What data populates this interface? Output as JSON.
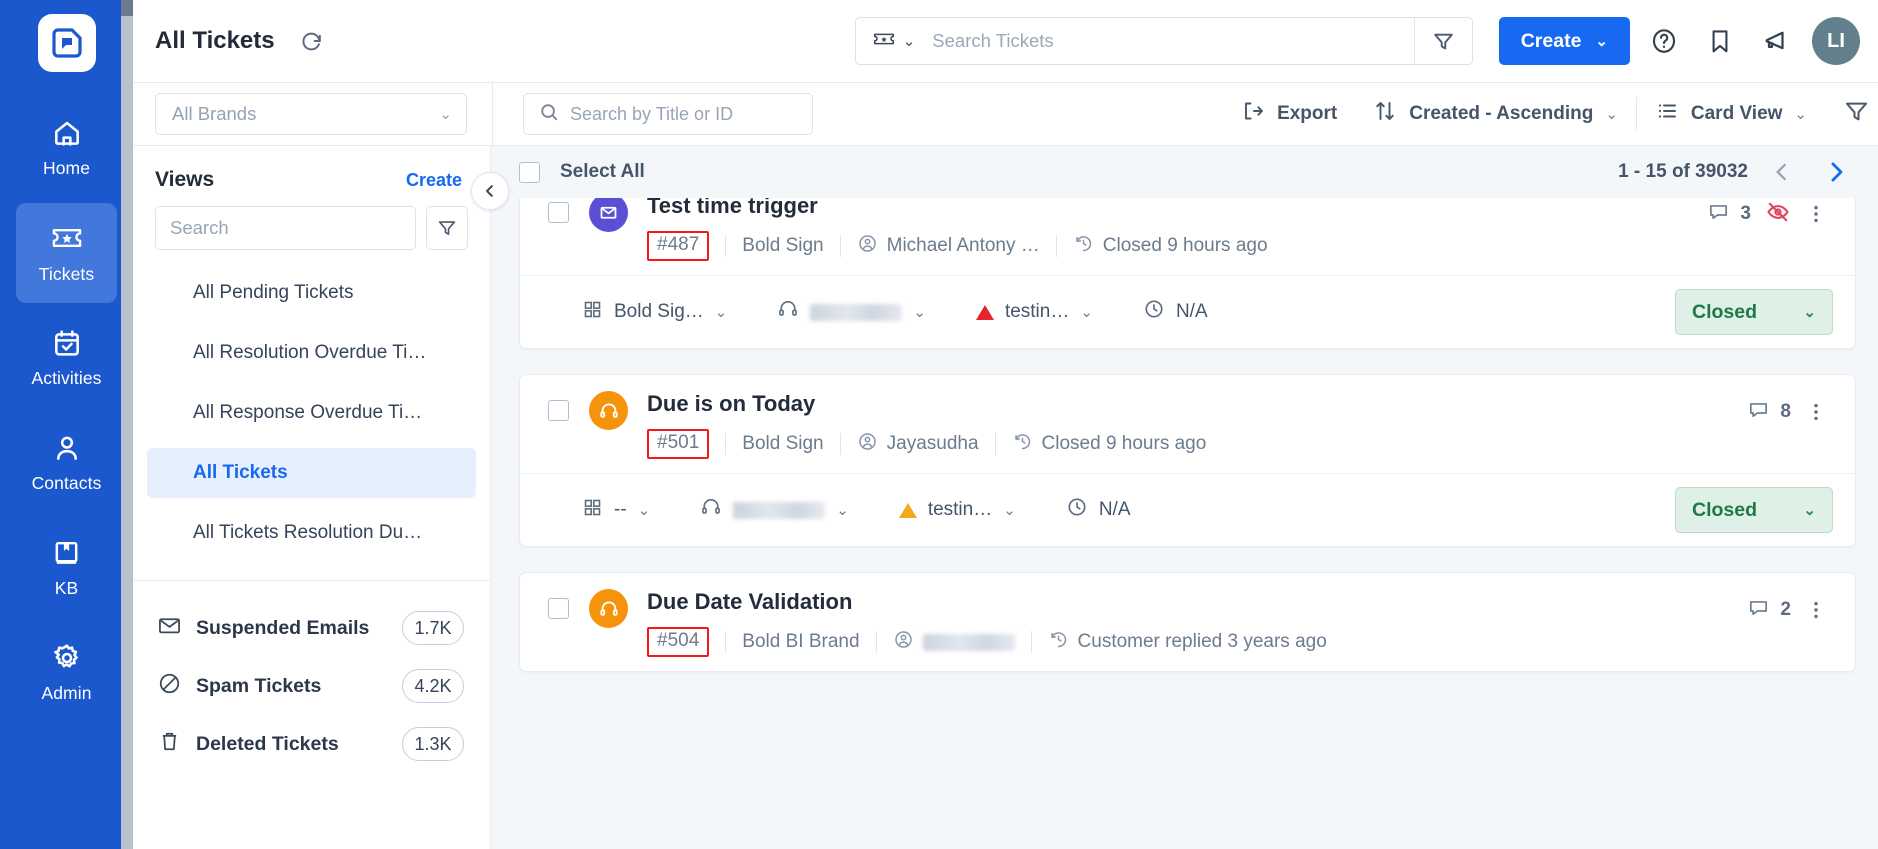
{
  "colors": {
    "rail_bg": "#1c58cd",
    "rail_active": "#4277dc",
    "accent": "#1869f1",
    "highlight_box": "#ee1c1c",
    "status_closed_bg": "#dff0e6",
    "status_closed_text": "#1d7a46",
    "priority_urgent": "#e7232c",
    "priority_high": "#f6a81c"
  },
  "rail": {
    "logo_icon": "bold-desk-logo-icon",
    "items": [
      {
        "label": "Home",
        "icon": "home-icon",
        "active": false
      },
      {
        "label": "Tickets",
        "icon": "ticket-icon",
        "active": true
      },
      {
        "label": "Activities",
        "icon": "calendar-check-icon",
        "active": false
      },
      {
        "label": "Contacts",
        "icon": "person-icon",
        "active": false
      },
      {
        "label": "KB",
        "icon": "book-bookmark-icon",
        "active": false
      },
      {
        "label": "Admin",
        "icon": "gear-icon",
        "active": false
      }
    ]
  },
  "topbar": {
    "title": "All Tickets",
    "refresh_icon": "refresh-icon",
    "search": {
      "type_icon": "ticket-icon",
      "type_chevron": "⌄",
      "placeholder": "Search Tickets",
      "value": "",
      "filter_icon": "funnel-icon"
    },
    "create_label": "Create",
    "create_chevron": "⌄",
    "icons": [
      {
        "name": "help-circle-icon",
        "glyph": "?"
      },
      {
        "name": "bookmark-icon",
        "glyph": ""
      },
      {
        "name": "megaphone-icon",
        "glyph": ""
      }
    ],
    "avatar_initials": "LI"
  },
  "toolbar": {
    "brand_filter": {
      "value": "All Brands",
      "chevron": "⌄"
    },
    "title_search": {
      "placeholder": "Search by Title or ID",
      "value": "",
      "icon": "search-icon"
    },
    "export_label": "Export",
    "export_icon": "export-icon",
    "sort_label": "Created - Ascending",
    "sort_icon": "sort-icon",
    "sort_chevron": "⌄",
    "view_label": "Card View",
    "view_icon": "list-icon",
    "view_chevron": "⌄",
    "filter_icon": "funnel-icon"
  },
  "views_panel": {
    "heading": "Views",
    "create_label": "Create",
    "collapse_icon": "chevron-left-icon",
    "search": {
      "placeholder": "Search",
      "value": ""
    },
    "filter_icon": "funnel-icon",
    "items": [
      {
        "label": "All Pending Tickets",
        "active": false
      },
      {
        "label": "All Resolution Overdue Ti…",
        "active": false
      },
      {
        "label": "All Response Overdue Ti…",
        "active": false
      },
      {
        "label": "All Tickets",
        "active": true
      },
      {
        "label": "All Tickets Resolution Du…",
        "active": false
      }
    ],
    "system_items": [
      {
        "label": "Suspended Emails",
        "count": "1.7K",
        "icon": "envelope-icon"
      },
      {
        "label": "Spam Tickets",
        "count": "4.2K",
        "icon": "ban-icon"
      },
      {
        "label": "Deleted Tickets",
        "count": "1.3K",
        "icon": "trash-icon"
      }
    ]
  },
  "list": {
    "select_all_label": "Select All",
    "pager_text": "1 - 15 of 39032",
    "prev_icon": "chevron-left-icon",
    "next_icon": "chevron-right-icon",
    "tickets": [
      {
        "title": "Test time trigger",
        "channel_icon": "email-icon",
        "channel_type": "mail",
        "id": "#487",
        "brand": "Bold Sign",
        "requester": "Michael Antony …",
        "requester_icon": "user-circle-icon",
        "activity": "Closed 9 hours ago",
        "activity_icon": "history-icon",
        "conversation_count": "3",
        "conversation_icon": "comment-icon",
        "has_eye_off": true,
        "eye_off_icon": "eye-off-icon",
        "kebab_icon": "kebab-menu-icon",
        "group": {
          "label": "Bold Sig…",
          "icon": "grid-icon"
        },
        "agent": {
          "label": "",
          "blurred": true,
          "icon": "headset-icon"
        },
        "priority": {
          "label": "testin…",
          "level": "urgent"
        },
        "due": {
          "label": "N/A",
          "icon": "clock-icon"
        },
        "status": "Closed"
      },
      {
        "title": "Due is on Today",
        "channel_icon": "headset-icon",
        "channel_type": "phone",
        "id": "#501",
        "brand": "Bold Sign",
        "requester": "Jayasudha",
        "requester_icon": "user-circle-icon",
        "activity": "Closed 9 hours ago",
        "activity_icon": "history-icon",
        "conversation_count": "8",
        "conversation_icon": "comment-icon",
        "has_eye_off": false,
        "kebab_icon": "kebab-menu-icon",
        "group": {
          "label": "--",
          "icon": "grid-icon"
        },
        "agent": {
          "label": "",
          "blurred": true,
          "icon": "headset-icon"
        },
        "priority": {
          "label": "testin…",
          "level": "high"
        },
        "due": {
          "label": "N/A",
          "icon": "clock-icon"
        },
        "status": "Closed"
      },
      {
        "title": "Due Date Validation",
        "channel_icon": "headset-icon",
        "channel_type": "phone",
        "id": "#504",
        "brand": "Bold BI Brand",
        "requester": "",
        "requester_blurred": true,
        "requester_icon": "user-circle-icon",
        "activity": "Customer replied 3 years ago",
        "activity_icon": "history-icon",
        "conversation_count": "2",
        "conversation_icon": "comment-icon",
        "has_eye_off": false,
        "kebab_icon": "kebab-menu-icon"
      }
    ]
  }
}
